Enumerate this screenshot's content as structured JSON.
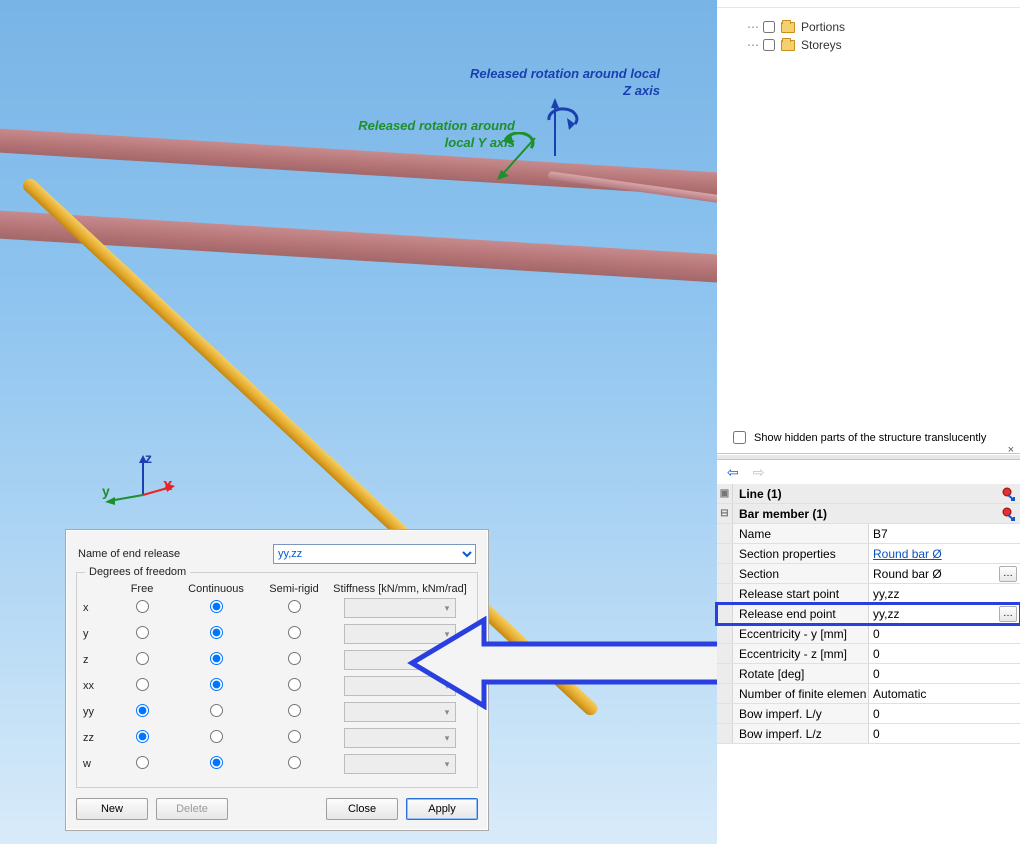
{
  "viewport": {
    "annotation_z": "Released rotation around local Z axis",
    "annotation_y": "Released rotation around local Y axis",
    "axis_labels": {
      "x": "x",
      "y": "y",
      "z": "z"
    }
  },
  "dialog": {
    "name_label": "Name of end release",
    "name_value": "yy,zz",
    "group_label": "Degrees of freedom",
    "columns": {
      "free": "Free",
      "continuous": "Continuous",
      "semirigid": "Semi-rigid",
      "stiffness": "Stiffness [kN/mm, kNm/rad]"
    },
    "rows": [
      {
        "label": "x",
        "selected": "continuous"
      },
      {
        "label": "y",
        "selected": "continuous"
      },
      {
        "label": "z",
        "selected": "continuous"
      },
      {
        "label": "xx",
        "selected": "continuous"
      },
      {
        "label": "yy",
        "selected": "free"
      },
      {
        "label": "zz",
        "selected": "free"
      },
      {
        "label": "w",
        "selected": "continuous"
      }
    ],
    "buttons": {
      "new": "New",
      "delete": "Delete",
      "close": "Close",
      "apply": "Apply"
    }
  },
  "tree": {
    "items": [
      {
        "label": "Portions"
      },
      {
        "label": "Storeys"
      }
    ],
    "show_hidden_label": "Show hidden parts of the structure translucently"
  },
  "properties": {
    "line_header": "Line (1)",
    "bar_header": "Bar member (1)",
    "rows": [
      {
        "key": "Name",
        "value": "B7"
      },
      {
        "key": "Section properties",
        "value": "Round bar Ø",
        "link": true
      },
      {
        "key": "Section",
        "value": "Round bar Ø",
        "ellipsis": true
      },
      {
        "key": "Release start point",
        "value": "yy,zz"
      },
      {
        "key": "Release end point",
        "value": "yy,zz",
        "ellipsis": true,
        "highlight": true
      },
      {
        "key": "Eccentricity - y [mm]",
        "value": "0"
      },
      {
        "key": "Eccentricity - z [mm]",
        "value": "0"
      },
      {
        "key": "Rotate [deg]",
        "value": "0"
      },
      {
        "key": "Number of finite elemen",
        "value": "Automatic"
      },
      {
        "key": "Bow imperf. L/y",
        "value": "0"
      },
      {
        "key": "Bow imperf. L/z",
        "value": "0"
      }
    ]
  }
}
